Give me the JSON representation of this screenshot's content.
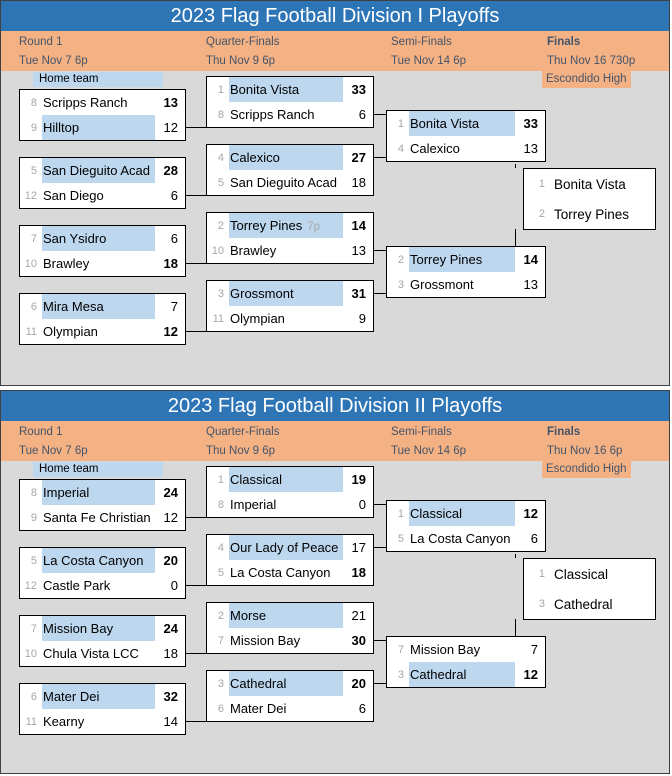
{
  "colors": {
    "header_blue": "#2e75b6",
    "band_orange": "#f4b183",
    "home_highlight": "#bdd7ee",
    "panel_grey": "#d9d9d9",
    "seed_grey": "#a6a6a6",
    "heading_text": "#44546a"
  },
  "legend": {
    "home_team": "Home team"
  },
  "divisions": [
    {
      "title": "2023 Flag Football Division I Playoffs",
      "rounds": [
        {
          "name": "Round 1",
          "date": "Tue Nov 7  6p",
          "bold": false
        },
        {
          "name": "Quarter-Finals",
          "date": "Thu Nov 9  6p",
          "bold": false
        },
        {
          "name": "Semi-Finals",
          "date": "Tue Nov 14  6p",
          "bold": false
        },
        {
          "name": "Finals",
          "date": "Thu Nov 16  730p",
          "bold": true
        }
      ],
      "venue": "Escondido High",
      "round1": [
        {
          "top": {
            "seed": "8",
            "team": "Scripps Ranch",
            "score": "13",
            "home": false,
            "win": true
          },
          "bot": {
            "seed": "9",
            "team": "Hilltop",
            "score": "12",
            "home": true,
            "win": false
          }
        },
        {
          "top": {
            "seed": "5",
            "team": "San Dieguito Acad",
            "score": "28",
            "home": true,
            "win": true
          },
          "bot": {
            "seed": "12",
            "team": "San Diego",
            "score": "6",
            "home": false,
            "win": false
          }
        },
        {
          "top": {
            "seed": "7",
            "team": "San Ysidro",
            "score": "6",
            "home": true,
            "win": false
          },
          "bot": {
            "seed": "10",
            "team": "Brawley",
            "score": "18",
            "home": false,
            "win": true
          }
        },
        {
          "top": {
            "seed": "6",
            "team": "Mira Mesa",
            "score": "7",
            "home": true,
            "win": false
          },
          "bot": {
            "seed": "11",
            "team": "Olympian",
            "score": "12",
            "home": false,
            "win": true
          }
        }
      ],
      "quarters": [
        {
          "top": {
            "seed": "1",
            "team": "Bonita Vista",
            "score": "33",
            "home": true,
            "win": true
          },
          "bot": {
            "seed": "8",
            "team": "Scripps Ranch",
            "score": "6",
            "home": false,
            "win": false
          }
        },
        {
          "top": {
            "seed": "4",
            "team": "Calexico",
            "score": "27",
            "home": true,
            "win": true
          },
          "bot": {
            "seed": "5",
            "team": "San Dieguito Acad",
            "score": "18",
            "home": false,
            "win": false
          }
        },
        {
          "top": {
            "seed": "2",
            "team": "Torrey Pines",
            "time": "7p",
            "score": "14",
            "home": true,
            "win": true
          },
          "bot": {
            "seed": "10",
            "team": "Brawley",
            "score": "13",
            "home": false,
            "win": false
          }
        },
        {
          "top": {
            "seed": "3",
            "team": "Grossmont",
            "score": "31",
            "home": true,
            "win": true
          },
          "bot": {
            "seed": "11",
            "team": "Olympian",
            "score": "9",
            "home": false,
            "win": false
          }
        }
      ],
      "semis": [
        {
          "top": {
            "seed": "1",
            "team": "Bonita Vista",
            "score": "33",
            "home": true,
            "win": true
          },
          "bot": {
            "seed": "4",
            "team": "Calexico",
            "score": "13",
            "home": false,
            "win": false
          }
        },
        {
          "top": {
            "seed": "2",
            "team": "Torrey Pines",
            "score": "14",
            "home": true,
            "win": true
          },
          "bot": {
            "seed": "3",
            "team": "Grossmont",
            "score": "13",
            "home": false,
            "win": false
          }
        }
      ],
      "final": {
        "top": {
          "seed": "1",
          "team": "Bonita Vista",
          "score": "",
          "home": false,
          "win": false
        },
        "bot": {
          "seed": "2",
          "team": "Torrey Pines",
          "score": "",
          "home": false,
          "win": false
        }
      }
    },
    {
      "title": "2023 Flag Football Division II Playoffs",
      "rounds": [
        {
          "name": "Round 1",
          "date": "Tue Nov 7  6p",
          "bold": false
        },
        {
          "name": "Quarter-Finals",
          "date": "Thu Nov 9  6p",
          "bold": false
        },
        {
          "name": "Semi-Finals",
          "date": "Tue Nov 14  6p",
          "bold": false
        },
        {
          "name": "Finals",
          "date": "Thu Nov 16  6p",
          "bold": true
        }
      ],
      "venue": "Escondido High",
      "round1": [
        {
          "top": {
            "seed": "8",
            "team": "Imperial",
            "score": "24",
            "home": true,
            "win": true
          },
          "bot": {
            "seed": "9",
            "team": "Santa Fe Christian",
            "score": "12",
            "home": false,
            "win": false
          }
        },
        {
          "top": {
            "seed": "5",
            "team": "La Costa Canyon",
            "score": "20",
            "home": true,
            "win": true
          },
          "bot": {
            "seed": "12",
            "team": "Castle Park",
            "score": "0",
            "home": false,
            "win": false
          }
        },
        {
          "top": {
            "seed": "7",
            "team": "Mission Bay",
            "score": "24",
            "home": true,
            "win": true
          },
          "bot": {
            "seed": "10",
            "team": "Chula Vista LCC",
            "score": "18",
            "home": false,
            "win": false
          }
        },
        {
          "top": {
            "seed": "6",
            "team": "Mater Dei",
            "score": "32",
            "home": true,
            "win": true
          },
          "bot": {
            "seed": "11",
            "team": "Kearny",
            "score": "14",
            "home": false,
            "win": false
          }
        }
      ],
      "quarters": [
        {
          "top": {
            "seed": "1",
            "team": "Classical",
            "score": "19",
            "home": true,
            "win": true
          },
          "bot": {
            "seed": "8",
            "team": "Imperial",
            "score": "0",
            "home": false,
            "win": false
          }
        },
        {
          "top": {
            "seed": "4",
            "team": "Our Lady of Peace",
            "score": "17",
            "home": true,
            "win": false
          },
          "bot": {
            "seed": "5",
            "team": "La Costa Canyon",
            "score": "18",
            "home": false,
            "win": true
          }
        },
        {
          "top": {
            "seed": "2",
            "team": "Morse",
            "score": "21",
            "home": true,
            "win": false
          },
          "bot": {
            "seed": "7",
            "team": "Mission Bay",
            "score": "30",
            "home": false,
            "win": true
          }
        },
        {
          "top": {
            "seed": "3",
            "team": "Cathedral",
            "score": "20",
            "home": true,
            "win": true
          },
          "bot": {
            "seed": "6",
            "team": "Mater Dei",
            "score": "6",
            "home": false,
            "win": false
          }
        }
      ],
      "semis": [
        {
          "top": {
            "seed": "1",
            "team": "Classical",
            "score": "12",
            "home": true,
            "win": true
          },
          "bot": {
            "seed": "5",
            "team": "La Costa Canyon",
            "score": "6",
            "home": false,
            "win": false
          }
        },
        {
          "top": {
            "seed": "7",
            "team": "Mission Bay",
            "score": "7",
            "home": false,
            "win": false
          },
          "bot": {
            "seed": "3",
            "team": "Cathedral",
            "score": "12",
            "home": true,
            "win": true
          }
        }
      ],
      "final": {
        "top": {
          "seed": "1",
          "team": "Classical",
          "score": "",
          "home": false,
          "win": false
        },
        "bot": {
          "seed": "3",
          "team": "Cathedral",
          "score": "",
          "home": false,
          "win": false
        }
      }
    }
  ]
}
